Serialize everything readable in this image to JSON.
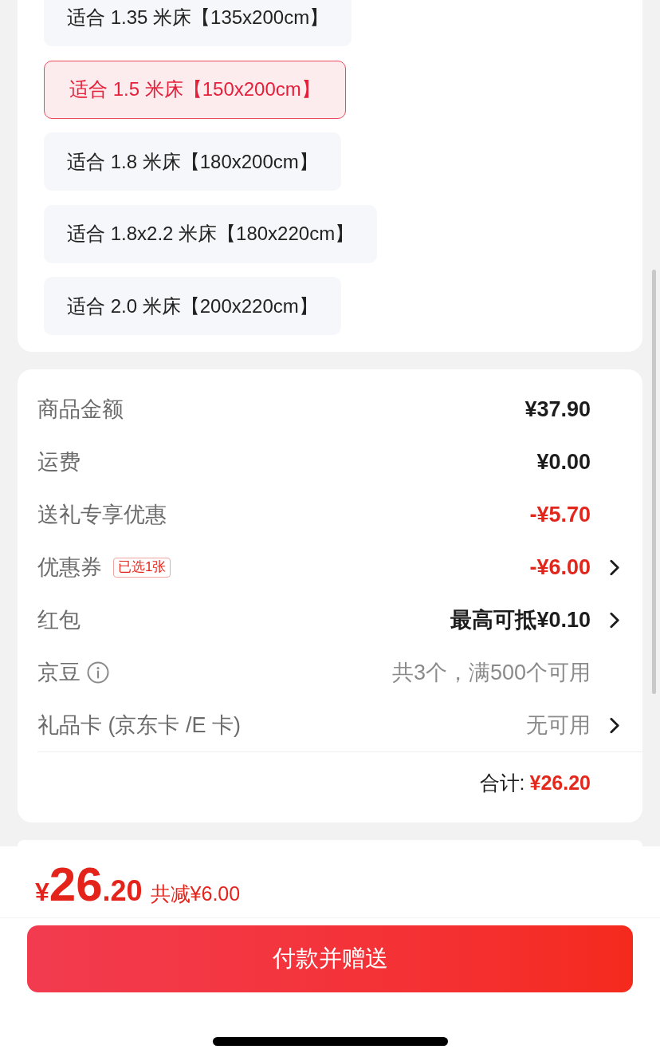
{
  "size_options": [
    {
      "label": "适合 1.35 米床【135x200cm】",
      "selected": false
    },
    {
      "label": "适合 1.5 米床【150x200cm】",
      "selected": true
    },
    {
      "label": "适合 1.8 米床【180x200cm】",
      "selected": false
    },
    {
      "label": "适合 1.8x2.2 米床【180x220cm】",
      "selected": false
    },
    {
      "label": "适合 2.0 米床【200x220cm】",
      "selected": false
    }
  ],
  "price_summary": {
    "rows": [
      {
        "label": "商品金额",
        "value": "¥37.90",
        "kind": "amount",
        "info": false,
        "chevron": false
      },
      {
        "label": "运费",
        "value": "¥0.00",
        "kind": "amount",
        "info": false,
        "chevron": false
      },
      {
        "label": "送礼专享优惠",
        "value": "-¥5.70",
        "kind": "discount",
        "info": false,
        "chevron": false
      },
      {
        "label": "优惠券",
        "badge": "已选1张",
        "value": "-¥6.00",
        "kind": "discount",
        "info": false,
        "chevron": true
      },
      {
        "label": "红包",
        "value": "最高可抵¥0.10",
        "kind": "amount",
        "info": false,
        "chevron": true
      },
      {
        "label": "京豆",
        "value": "共3个，满500个可用",
        "kind": "hint",
        "info": true,
        "chevron": false
      },
      {
        "label": "礼品卡 (京东卡 /E 卡)",
        "value": "无可用",
        "kind": "hint",
        "info": false,
        "chevron": true
      }
    ],
    "total": {
      "label": "合计:",
      "value": "¥26.20"
    }
  },
  "checkout_bar": {
    "price": {
      "currency": "¥",
      "integer": "26",
      "decimal": ".20"
    },
    "savings": "共减¥6.00",
    "pay_button": "付款并赠送"
  }
}
